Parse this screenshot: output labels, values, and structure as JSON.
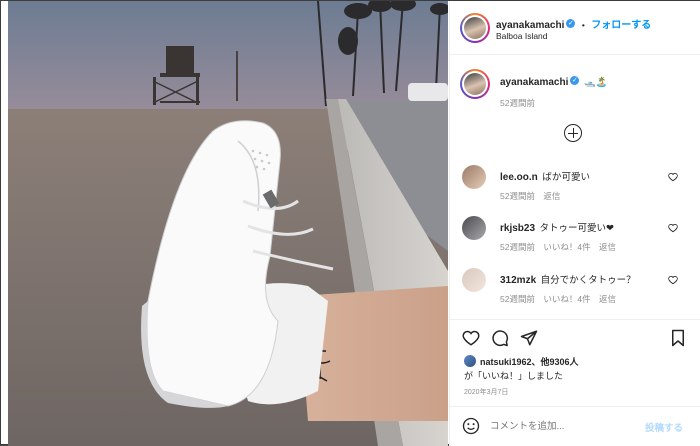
{
  "post": {
    "username": "ayanakamachi",
    "dot": "•",
    "follow_label": "フォローする",
    "location": "Balboa Island"
  },
  "caption": {
    "username": "ayanakamachi",
    "text": "🛥️🏝️",
    "time": "52週間前"
  },
  "comments": [
    {
      "user": "lee.oo.n",
      "text": "ばか可愛い",
      "time": "52週間前",
      "likes": "",
      "reply": "返信"
    },
    {
      "user": "rkjsb23",
      "text": "タトゥー可愛い❤",
      "time": "52週間前",
      "likes": "いいね！4件",
      "reply": "返信"
    },
    {
      "user": "312mzk",
      "text": "自分でかくタトゥー？",
      "time": "52週間前",
      "likes": "いいね！4件",
      "reply": "返信"
    }
  ],
  "likes": {
    "line1": "natsuki1962、他9306人",
    "line2": "が「いいね！」しました"
  },
  "date": "2020年3月7日",
  "comment_input": {
    "placeholder": "コメントを追加...",
    "post_label": "投稿する"
  },
  "colors": {
    "accent": "#0095f6",
    "verified": "#3897f0",
    "text": "#262626",
    "muted": "#8e8e8e"
  }
}
